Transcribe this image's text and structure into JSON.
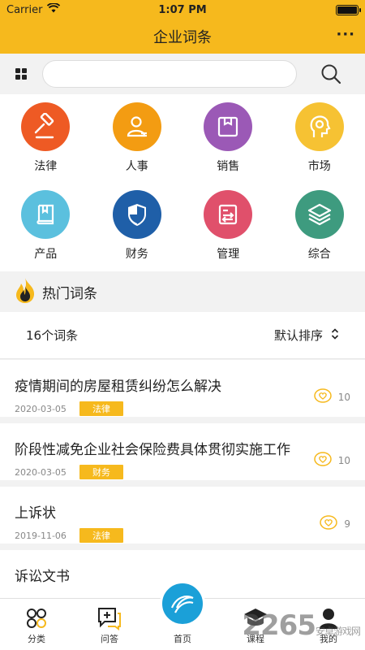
{
  "status_bar": {
    "carrier": "Carrier",
    "time": "1:07 PM"
  },
  "nav": {
    "title": "企业词条",
    "more_label": "···"
  },
  "search": {
    "placeholder": ""
  },
  "categories": [
    {
      "label": "法律",
      "color": "#ee5a24",
      "icon": "gavel-icon"
    },
    {
      "label": "人事",
      "color": "#f39c12",
      "icon": "person-icon"
    },
    {
      "label": "销售",
      "color": "#9b59b6",
      "icon": "box-icon"
    },
    {
      "label": "市场",
      "color": "#f6c233",
      "icon": "head-icon"
    },
    {
      "label": "产品",
      "color": "#5bc0de",
      "icon": "book-icon"
    },
    {
      "label": "财务",
      "color": "#1f5fa8",
      "icon": "shield-icon"
    },
    {
      "label": "管理",
      "color": "#e0506b",
      "icon": "transfer-icon"
    },
    {
      "label": "综合",
      "color": "#3e9b7f",
      "icon": "layers-icon"
    }
  ],
  "hot": {
    "title": "热门词条"
  },
  "list": {
    "count_label": "16个词条",
    "sort_label": "默认排序"
  },
  "entries": [
    {
      "title": "疫情期间的房屋租赁纠纷怎么解决",
      "date": "2020-03-05",
      "tag": "法律",
      "likes": "10"
    },
    {
      "title": "阶段性减免企业社会保险费具体贯彻实施工作",
      "date": "2020-03-05",
      "tag": "财务",
      "likes": "10"
    },
    {
      "title": "上诉状",
      "date": "2019-11-06",
      "tag": "法律",
      "likes": "9"
    },
    {
      "title": "诉讼文书",
      "date": "",
      "tag": "",
      "likes": ""
    }
  ],
  "tabs": [
    {
      "label": "分类"
    },
    {
      "label": "问答"
    },
    {
      "label": "首页"
    },
    {
      "label": "课程"
    },
    {
      "label": "我的"
    }
  ],
  "watermark": {
    "text": "2265",
    "sub": "安卓游戏网"
  },
  "colors": {
    "accent": "#f6b91d",
    "home": "#1ba0d8"
  }
}
